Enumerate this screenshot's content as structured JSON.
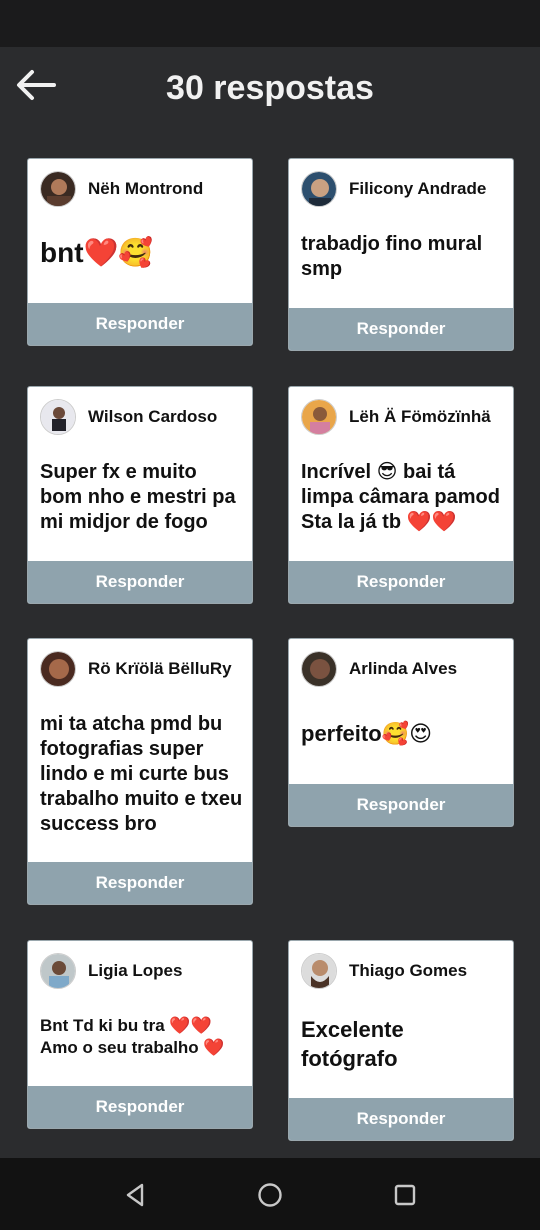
{
  "header": {
    "title": "30 respostas"
  },
  "reply_label": "Responder",
  "comments": [
    {
      "name": "Nëh Montrond",
      "text": "bnt❤️🥰"
    },
    {
      "name": "Filicony Andrade",
      "text": "trabadjo fino mural smp"
    },
    {
      "name": "Wilson Cardoso",
      "text": "Super fx e muito bom nho e mestri pa mi midjor de fogo"
    },
    {
      "name": "Lëh Ä Fömözïnhä",
      "text": "Incrível 😎 bai tá limpa câmara pamod Sta la já tb ❤️❤️"
    },
    {
      "name": "Rö Krïölä BëlluRy",
      "text": "mi ta atcha pmd bu fotografias super lindo e mi curte bus trabalho  muito e txeu success  bro"
    },
    {
      "name": "Arlinda Alves",
      "text": "perfeito🥰😍"
    },
    {
      "name": "Ligia Lopes",
      "text": "Bnt Td ki bu tra ❤️❤️ Amo o seu trabalho ❤️"
    },
    {
      "name": "Thiago Gomes",
      "text": "Excelente fotógrafo"
    }
  ],
  "icons": {
    "back": "back-arrow-icon",
    "nav": [
      "back-triangle-icon",
      "home-circle-icon",
      "recents-square-icon"
    ]
  },
  "colors": {
    "background": "#2b2c2e",
    "card": "#ffffff",
    "reply_button": "#8fa3ad",
    "title": "#f1f1f1"
  }
}
